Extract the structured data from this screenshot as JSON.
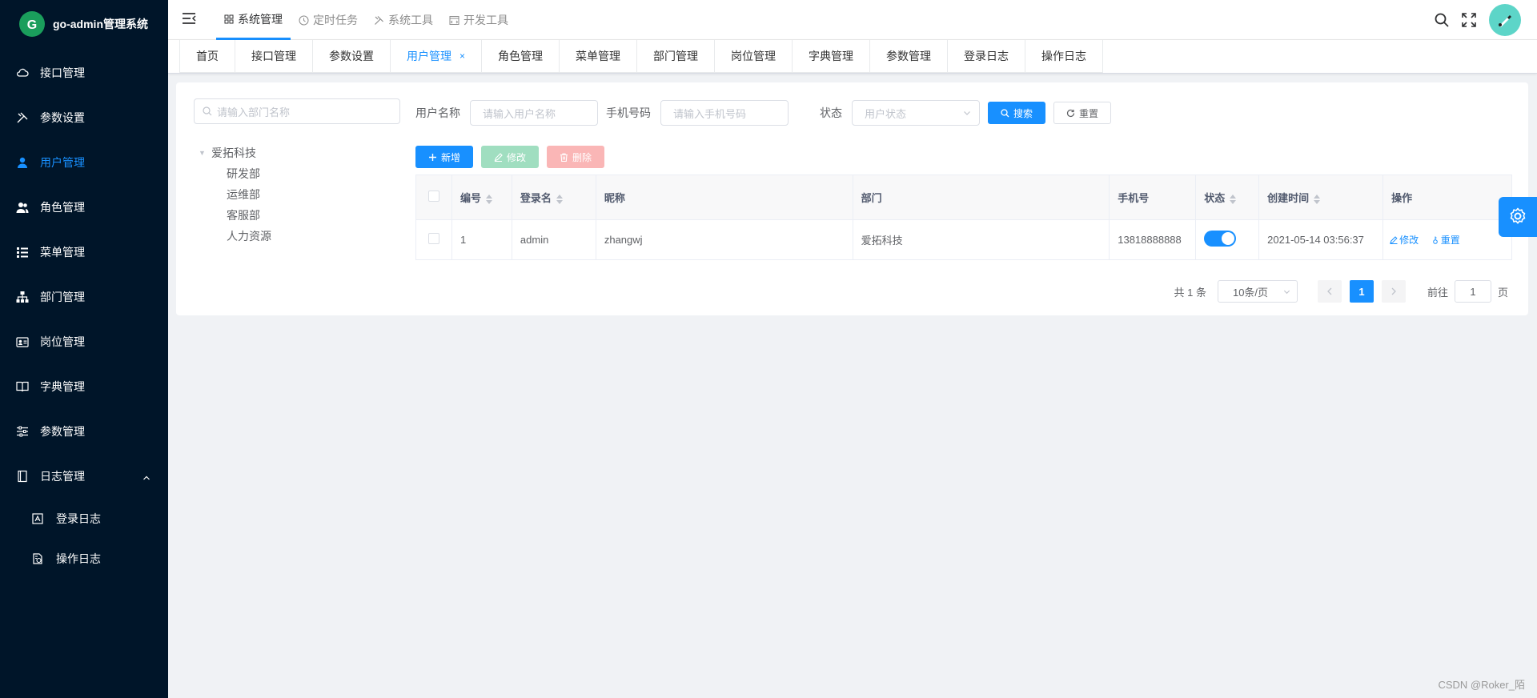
{
  "app": {
    "title": "go-admin管理系统",
    "logo_letter": "G"
  },
  "sidebar": {
    "items": [
      {
        "label": "接口管理",
        "icon": "cloud-icon"
      },
      {
        "label": "参数设置",
        "icon": "tools-icon"
      },
      {
        "label": "用户管理",
        "icon": "user-icon",
        "active": true
      },
      {
        "label": "角色管理",
        "icon": "users-icon"
      },
      {
        "label": "菜单管理",
        "icon": "tree-table-icon"
      },
      {
        "label": "部门管理",
        "icon": "org-icon"
      },
      {
        "label": "岗位管理",
        "icon": "badge-icon"
      },
      {
        "label": "字典管理",
        "icon": "book-icon"
      },
      {
        "label": "参数管理",
        "icon": "sliders-icon"
      },
      {
        "label": "日志管理",
        "icon": "log-icon",
        "expanded": true
      }
    ],
    "sub_items": [
      {
        "label": "登录日志",
        "icon": "login-log-icon"
      },
      {
        "label": "操作日志",
        "icon": "operate-log-icon"
      }
    ]
  },
  "topnav": {
    "items": [
      {
        "label": "系统管理",
        "active": true
      },
      {
        "label": "定时任务"
      },
      {
        "label": "系统工具"
      },
      {
        "label": "开发工具"
      }
    ]
  },
  "tags": {
    "items": [
      {
        "label": "首页"
      },
      {
        "label": "接口管理"
      },
      {
        "label": "参数设置"
      },
      {
        "label": "用户管理",
        "active": true,
        "close": "×"
      },
      {
        "label": "角色管理"
      },
      {
        "label": "菜单管理"
      },
      {
        "label": "部门管理"
      },
      {
        "label": "岗位管理"
      },
      {
        "label": "字典管理"
      },
      {
        "label": "参数管理"
      },
      {
        "label": "登录日志"
      },
      {
        "label": "操作日志"
      }
    ]
  },
  "dept": {
    "search_placeholder": "请输入部门名称",
    "root": "爱拓科技",
    "children": [
      "研发部",
      "运维部",
      "客服部",
      "人力资源"
    ]
  },
  "filters": {
    "username_label": "用户名称",
    "username_placeholder": "请输入用户名称",
    "phone_label": "手机号码",
    "phone_placeholder": "请输入手机号码",
    "status_label": "状态",
    "status_placeholder": "用户状态",
    "search_btn": "搜索",
    "reset_btn": "重置"
  },
  "toolbar": {
    "add": "新增",
    "edit": "修改",
    "delete": "删除"
  },
  "table": {
    "headers": {
      "id": "编号",
      "login": "登录名",
      "nickname": "昵称",
      "dept": "部门",
      "phone": "手机号",
      "status": "状态",
      "created": "创建时间",
      "ops": "操作"
    },
    "rows": [
      {
        "id": "1",
        "login": "admin",
        "nickname": "zhangwj",
        "dept": "爱拓科技",
        "phone": "13818888888",
        "status_on": true,
        "created": "2021-05-14 03:56:37",
        "edit": "修改",
        "reset": "重置"
      }
    ]
  },
  "pagination": {
    "total": "共 1 条",
    "page_size": "10条/页",
    "current": "1",
    "goto_label": "前往",
    "goto_value": "1",
    "page_unit": "页"
  },
  "watermark": "CSDN @Roker_陌",
  "colors": {
    "primary": "#1890ff",
    "sidebar_bg": "#001529"
  }
}
